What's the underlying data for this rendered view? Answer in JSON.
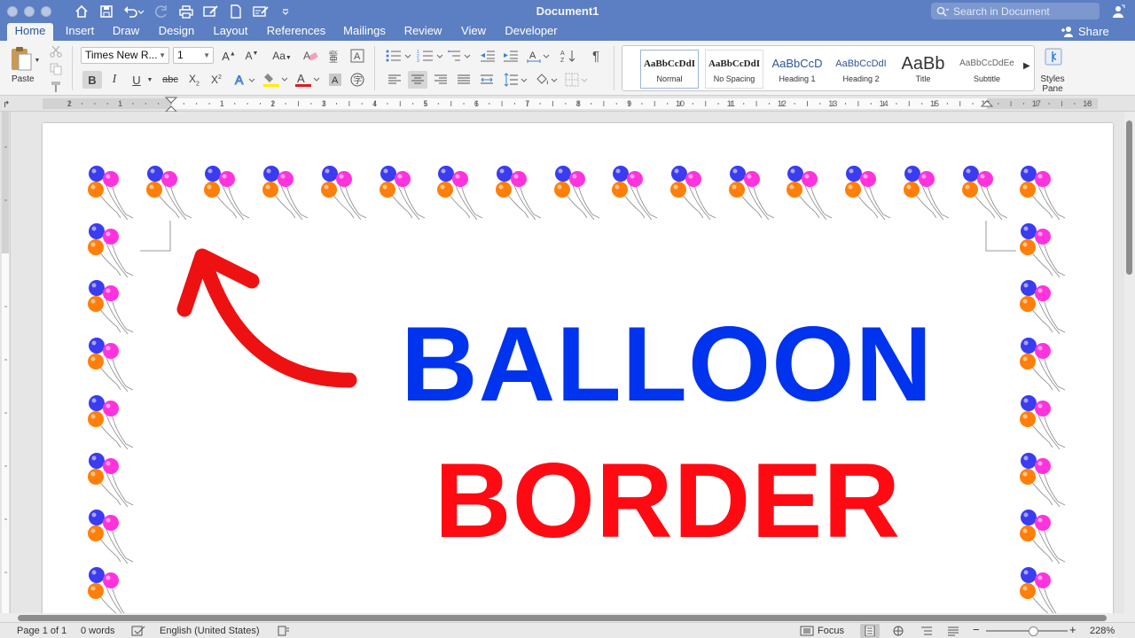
{
  "window": {
    "title": "Document1",
    "search_placeholder": "Search in Document"
  },
  "tabs": [
    {
      "label": "Home"
    },
    {
      "label": "Insert"
    },
    {
      "label": "Draw"
    },
    {
      "label": "Design"
    },
    {
      "label": "Layout"
    },
    {
      "label": "References"
    },
    {
      "label": "Mailings"
    },
    {
      "label": "Review"
    },
    {
      "label": "View"
    },
    {
      "label": "Developer"
    }
  ],
  "share_label": "Share",
  "ribbon": {
    "paste_label": "Paste",
    "font_name": "Times New R...",
    "font_size": "1",
    "styles": [
      {
        "sample": "AaBbCcDdI",
        "name": "Normal"
      },
      {
        "sample": "AaBbCcDdI",
        "name": "No Spacing"
      },
      {
        "sample": "AaBbCcD",
        "name": "Heading 1"
      },
      {
        "sample": "AaBbCcDdI",
        "name": "Heading 2"
      },
      {
        "sample": "AaBb",
        "name": "Title"
      },
      {
        "sample": "AaBbCcDdEe",
        "name": "Subtitle"
      }
    ],
    "styles_pane_label": "Styles Pane"
  },
  "ruler": {
    "labels": [
      "2",
      "1",
      "1",
      "2",
      "3",
      "4",
      "5",
      "6",
      "7",
      "8",
      "9",
      "10",
      "11",
      "12",
      "13",
      "14",
      "15",
      "16",
      "17",
      "18"
    ]
  },
  "document": {
    "line1": "BALLOON",
    "line2": "BORDER",
    "line1_color": "#0033ee",
    "line2_color": "#ff0a12",
    "arrow_color": "#ee1111",
    "balloon_colors": [
      "#3b3bf0",
      "#ff33dd",
      "#ff7f0a"
    ]
  },
  "status": {
    "page": "Page 1 of 1",
    "words": "0 words",
    "language": "English (United States)",
    "focus": "Focus",
    "zoom": "228%"
  },
  "colors": {
    "titlebar": "#5b7fc2",
    "accent": "#2b579a"
  }
}
